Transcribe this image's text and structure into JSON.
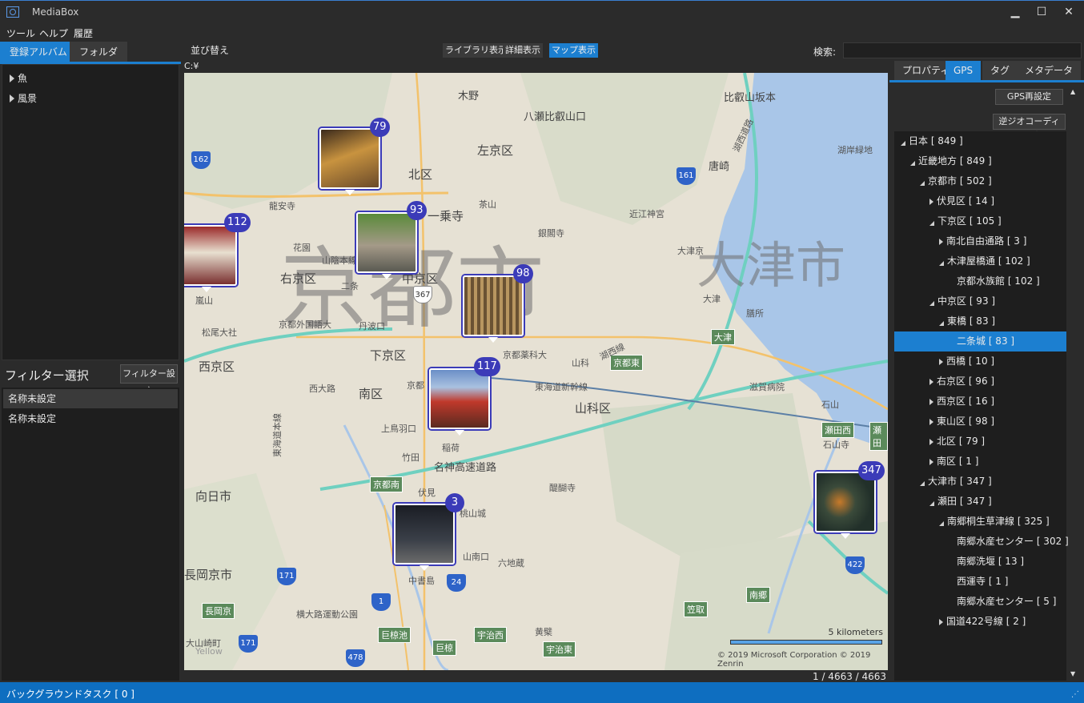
{
  "window": {
    "title": "MediaBox",
    "min_glyph": "▁",
    "max_glyph": "☐",
    "close_glyph": "✕"
  },
  "menu": [
    "ツール",
    "ヘルプ",
    "履歴"
  ],
  "left_tabs": [
    "登録アルバム",
    "フォルダ"
  ],
  "albums": [
    "魚",
    "風景"
  ],
  "filter": {
    "title": "フィルター選択",
    "settings_button": "フィルター設定",
    "items": [
      "名称未設定",
      "名称未設定"
    ]
  },
  "toolbar": {
    "sort_label": "並び替え",
    "view_buttons": [
      "ライブラリ表示",
      "詳細表示",
      "マップ表示"
    ],
    "active_view": "マップ表示",
    "path": "C:¥",
    "search_label": "検索:",
    "search_value": ""
  },
  "map": {
    "city_labels": [
      "京都市",
      "大津市"
    ],
    "pins": [
      {
        "count": "79"
      },
      {
        "count": "112"
      },
      {
        "count": "93"
      },
      {
        "count": "98"
      },
      {
        "count": "117"
      },
      {
        "count": "3"
      },
      {
        "count": "347"
      }
    ],
    "labels": [
      "木野",
      "八瀬比叡山口",
      "比叡山坂本",
      "湖西道路",
      "左京区",
      "唐崎",
      "湖岸緑地",
      "北区",
      "龍安寺",
      "一乗寺",
      "茶山",
      "近江神宮",
      "銀閣寺",
      "花園",
      "山陰本線",
      "二条",
      "大津京",
      "右京区",
      "中京区",
      "大津",
      "膳所",
      "京都外国語大",
      "丹波口",
      "京都薬科大",
      "山科",
      "西京区",
      "下京区",
      "京都東",
      "大津",
      "西大路",
      "京都",
      "東海道新幹線",
      "湖西線",
      "滋賀病院",
      "嵐山",
      "松尾大社",
      "南区",
      "山科区",
      "石山",
      "上鳥羽口",
      "稲荷",
      "竹田",
      "名神高速道路",
      "京都南",
      "伏見",
      "桃山城",
      "醍醐寺",
      "石山寺",
      "瀬田西",
      "瀬田",
      "向日市",
      "東海道本線",
      "長岡京市",
      "山南口",
      "六地蔵",
      "中書島",
      "横大路運動公園",
      "南郷",
      "笠取",
      "長岡京",
      "巨椋池",
      "宇治西",
      "黄檗",
      "巨椋",
      "宇治東",
      "大山崎町",
      "Yellow"
    ],
    "scale_label": "5 kilometers",
    "copyright": "© 2019 Microsoft Corporation   © 2019 Zenrin",
    "route_numbers": [
      "162",
      "161",
      "367",
      "171",
      "1",
      "24",
      "171",
      "478",
      "422"
    ]
  },
  "counter": "1  /  4663  /  4663",
  "right_tabs": [
    "プロパティ",
    "GPS",
    "タグ",
    "メタデータ"
  ],
  "active_right_tab": "GPS",
  "gps": {
    "reset_button": "GPS再設定",
    "reverse_geocode_button": "逆ジオコーディング",
    "tree": [
      {
        "label": "日本 [ 849 ]",
        "depth": 0,
        "expander": "open"
      },
      {
        "label": "近畿地方 [ 849 ]",
        "depth": 1,
        "expander": "open"
      },
      {
        "label": "京都市 [ 502 ]",
        "depth": 2,
        "expander": "open"
      },
      {
        "label": "伏見区 [ 14 ]",
        "depth": 3,
        "expander": "closed"
      },
      {
        "label": "下京区 [ 105 ]",
        "depth": 3,
        "expander": "open"
      },
      {
        "label": "南北自由通路 [ 3 ]",
        "depth": 4,
        "expander": "closed"
      },
      {
        "label": "木津屋橋通 [ 102 ]",
        "depth": 4,
        "expander": "open"
      },
      {
        "label": "京都水族館 [ 102 ]",
        "depth": 5,
        "expander": "none"
      },
      {
        "label": "中京区 [ 93 ]",
        "depth": 3,
        "expander": "open"
      },
      {
        "label": "東橋 [ 83 ]",
        "depth": 4,
        "expander": "open"
      },
      {
        "label": "二条城 [ 83 ]",
        "depth": 5,
        "expander": "none",
        "selected": true
      },
      {
        "label": "西橋 [ 10 ]",
        "depth": 4,
        "expander": "closed"
      },
      {
        "label": "右京区 [ 96 ]",
        "depth": 3,
        "expander": "closed"
      },
      {
        "label": "西京区 [ 16 ]",
        "depth": 3,
        "expander": "closed"
      },
      {
        "label": "東山区 [ 98 ]",
        "depth": 3,
        "expander": "closed"
      },
      {
        "label": "北区 [ 79 ]",
        "depth": 3,
        "expander": "closed"
      },
      {
        "label": "南区 [ 1 ]",
        "depth": 3,
        "expander": "closed"
      },
      {
        "label": "大津市 [ 347 ]",
        "depth": 2,
        "expander": "open"
      },
      {
        "label": "瀬田 [ 347 ]",
        "depth": 3,
        "expander": "open"
      },
      {
        "label": "南郷桐生草津線 [ 325 ]",
        "depth": 4,
        "expander": "open"
      },
      {
        "label": "南郷水産センター [ 302 ]",
        "depth": 5,
        "expander": "none"
      },
      {
        "label": "南郷洗堰 [ 13 ]",
        "depth": 5,
        "expander": "none"
      },
      {
        "label": "西運寺 [ 1 ]",
        "depth": 5,
        "expander": "none"
      },
      {
        "label": "南郷水産センター [ 5 ]",
        "depth": 5,
        "expander": "none"
      },
      {
        "label": "国道422号線 [ 2 ]",
        "depth": 4,
        "expander": "closed"
      }
    ]
  },
  "status": "バックグラウンドタスク [ 0 ]",
  "colors": {
    "accent": "#1c7fd0",
    "pin_badge": "#3b3bb8",
    "background": "#2b2b2b",
    "panel": "#1e1e1e"
  }
}
